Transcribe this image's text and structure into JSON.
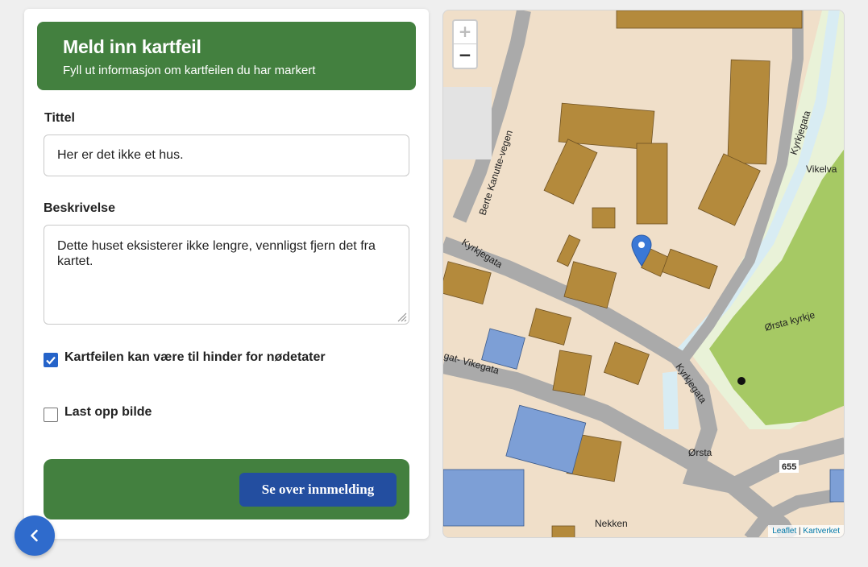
{
  "form": {
    "title": "Meld inn kartfeil",
    "subtitle": "Fyll ut informasjon om kartfeilen du har markert",
    "title_label": "Tittel",
    "title_value": "Her er det ikke et hus.",
    "desc_label": "Beskrivelse",
    "desc_value": "Dette huset eksisterer ikke lengre, vennligst fjern det fra kartet.",
    "checkbox_emergency": {
      "label": "Kartfeilen kan være til hinder for nødetater",
      "checked": true
    },
    "checkbox_photo": {
      "label": "Last opp bilde",
      "checked": false
    },
    "submit_label": "Se over innmelding"
  },
  "nav": {
    "back_icon": "chevron-left-icon"
  },
  "map": {
    "zoom_in": "+",
    "zoom_out": "−",
    "attribution": {
      "leaflet": "Leaflet",
      "separator": " | ",
      "provider": "Kartverket"
    },
    "labels": {
      "berte": "Berte Kanutte-vegen",
      "kyrkjegata_1": "Kyrkjegata",
      "kyrkjegata_2": "Kyrkjegata",
      "kyrkjegata_3": "Kyrkjegata",
      "vikelva": "Vikelva",
      "orsta_kyrkje": "Ørsta kyrkje",
      "vikegata": "gat- Vikegata",
      "orsta": "Ørsta",
      "road_655": "655",
      "nekken": "Nekken"
    },
    "marker_icon": "map-pin-icon",
    "colors": {
      "land": "#f0dfc9",
      "road": "#aaaaaa",
      "building": "#b48a3c",
      "public_building": "#7d9fd6",
      "park": "#a6c964",
      "water": "#d8ecf3",
      "marker": "#3a78d6"
    }
  }
}
